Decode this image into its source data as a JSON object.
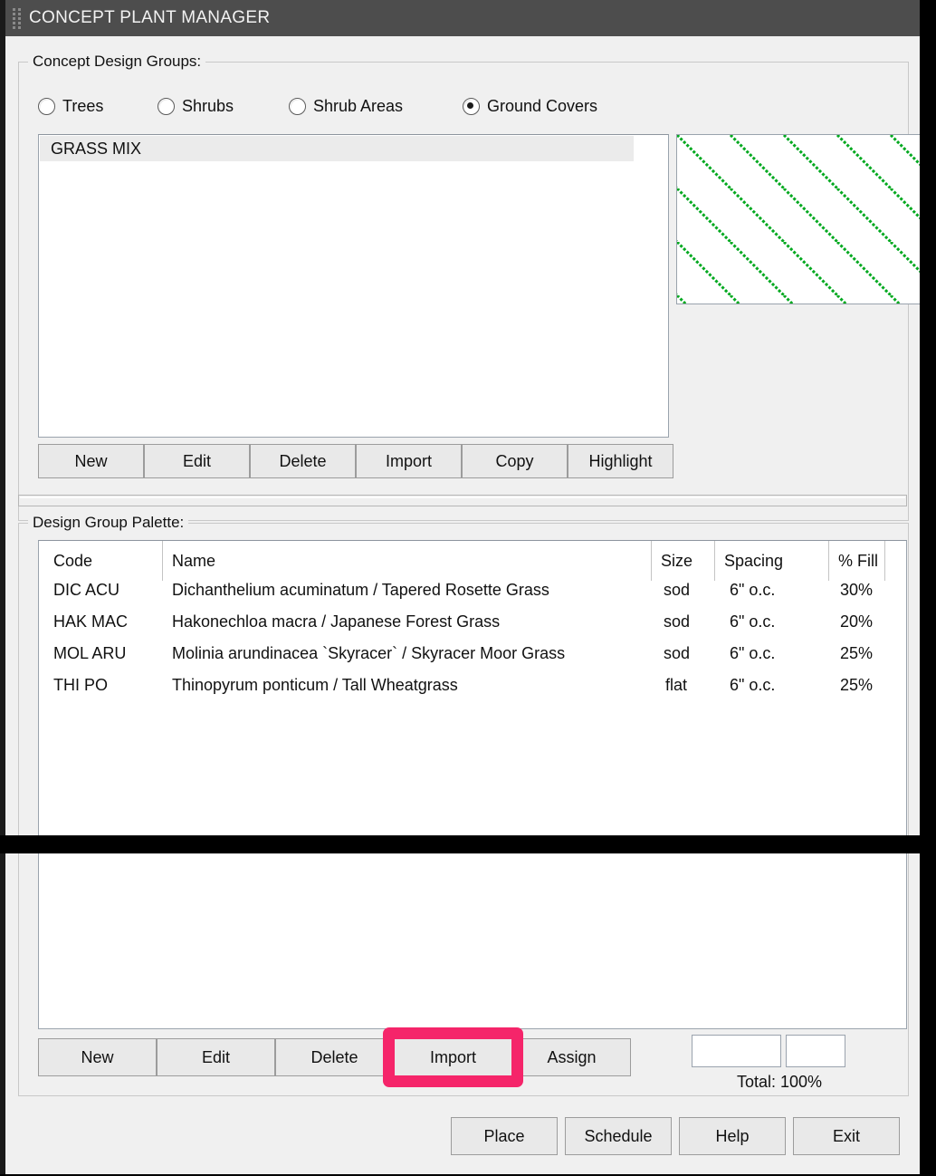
{
  "window": {
    "title": "CONCEPT PLANT MANAGER",
    "grip_icon": "drag-grip-icon"
  },
  "concept_design_groups": {
    "legend": "Concept Design Groups:",
    "radios": [
      {
        "label": "Trees",
        "selected": false
      },
      {
        "label": "Shrubs",
        "selected": false
      },
      {
        "label": "Shrub Areas",
        "selected": false
      },
      {
        "label": "Ground Covers",
        "selected": true
      }
    ],
    "list_items": [
      "GRASS MIX"
    ],
    "selected_item": "GRASS MIX",
    "preview": {
      "icon": "hatch-pattern-preview",
      "pattern": "diagonal-lines",
      "line_color": "#00a81e",
      "background": "#ffffff"
    },
    "buttons": [
      "New",
      "Edit",
      "Delete",
      "Import",
      "Copy",
      "Highlight"
    ]
  },
  "design_group_palette": {
    "legend": "Design Group Palette:",
    "columns": [
      "Code",
      "Name",
      "Size",
      "Spacing",
      "% Fill"
    ],
    "rows": [
      {
        "code": "DIC ACU",
        "name": "Dichanthelium acuminatum / Tapered Rosette Grass",
        "size": "sod",
        "spacing": "6\" o.c.",
        "fill": "30%"
      },
      {
        "code": "HAK MAC",
        "name": "Hakonechloa macra / Japanese Forest Grass",
        "size": "sod",
        "spacing": "6\" o.c.",
        "fill": "20%"
      },
      {
        "code": "MOL ARU",
        "name": "Molinia arundinacea `Skyracer` / Skyracer Moor Grass",
        "size": "sod",
        "spacing": "6\" o.c.",
        "fill": "25%"
      },
      {
        "code": "THI  PO",
        "name": "Thinopyrum  ponticum / Tall Wheatgrass",
        "size": "flat",
        "spacing": "6\" o.c.",
        "fill": "25%"
      }
    ],
    "buttons": [
      "New",
      "Edit",
      "Delete",
      "Import",
      "Assign"
    ],
    "highlighted_button": "Import",
    "highlight_color": "#f5256a",
    "fields": [
      {
        "name": "percent-field-1",
        "value": ""
      },
      {
        "name": "percent-field-2",
        "value": ""
      }
    ],
    "total_label": "Total: 100%"
  },
  "footer": {
    "buttons": [
      "Place",
      "Schedule",
      "Help",
      "Exit"
    ]
  }
}
